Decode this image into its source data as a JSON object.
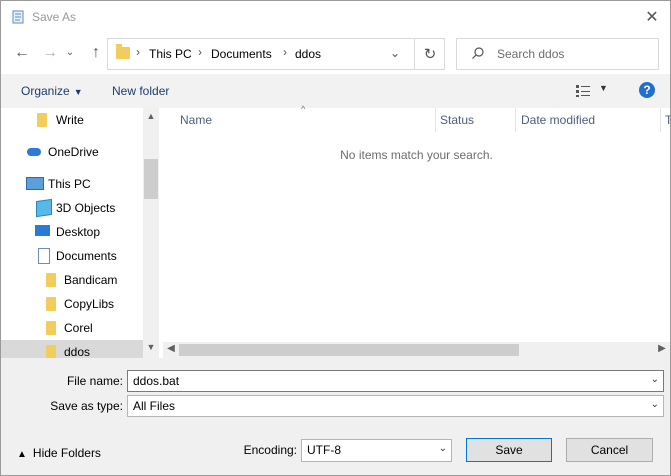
{
  "window": {
    "title": "Save As"
  },
  "address_bar": {
    "breadcrumbs": [
      "This PC",
      "Documents",
      "ddos"
    ]
  },
  "search": {
    "placeholder": "Search ddos"
  },
  "toolbar": {
    "organize_label": "Organize",
    "new_folder_label": "New folder"
  },
  "nav_tree": {
    "items": [
      {
        "label": "Write",
        "icon": "folder-icon"
      },
      {
        "label": "OneDrive",
        "icon": "cloud-icon"
      },
      {
        "label": "This PC",
        "icon": "computer-icon"
      },
      {
        "label": "3D Objects",
        "icon": "cube-icon"
      },
      {
        "label": "Desktop",
        "icon": "desktop-icon"
      },
      {
        "label": "Documents",
        "icon": "document-icon"
      },
      {
        "label": "Bandicam",
        "icon": "folder-icon"
      },
      {
        "label": "CopyLibs",
        "icon": "folder-icon"
      },
      {
        "label": "Corel",
        "icon": "folder-icon"
      },
      {
        "label": "ddos",
        "icon": "folder-icon",
        "selected": true
      }
    ]
  },
  "file_list": {
    "columns": [
      "Name",
      "Status",
      "Date modified",
      "T"
    ],
    "empty_message": "No items match your search."
  },
  "form": {
    "file_name_label": "File name:",
    "file_name_value": "ddos.bat",
    "save_as_type_label": "Save as type:",
    "save_as_type_value": "All Files",
    "encoding_label": "Encoding:",
    "encoding_value": "UTF-8"
  },
  "buttons": {
    "save_label": "Save",
    "cancel_label": "Cancel",
    "hide_folders_label": "Hide Folders"
  },
  "colors": {
    "accent": "#0078d7",
    "folder": "#f3cd5b",
    "selection": "#d9d9d9",
    "help": "#1f6fd0"
  }
}
